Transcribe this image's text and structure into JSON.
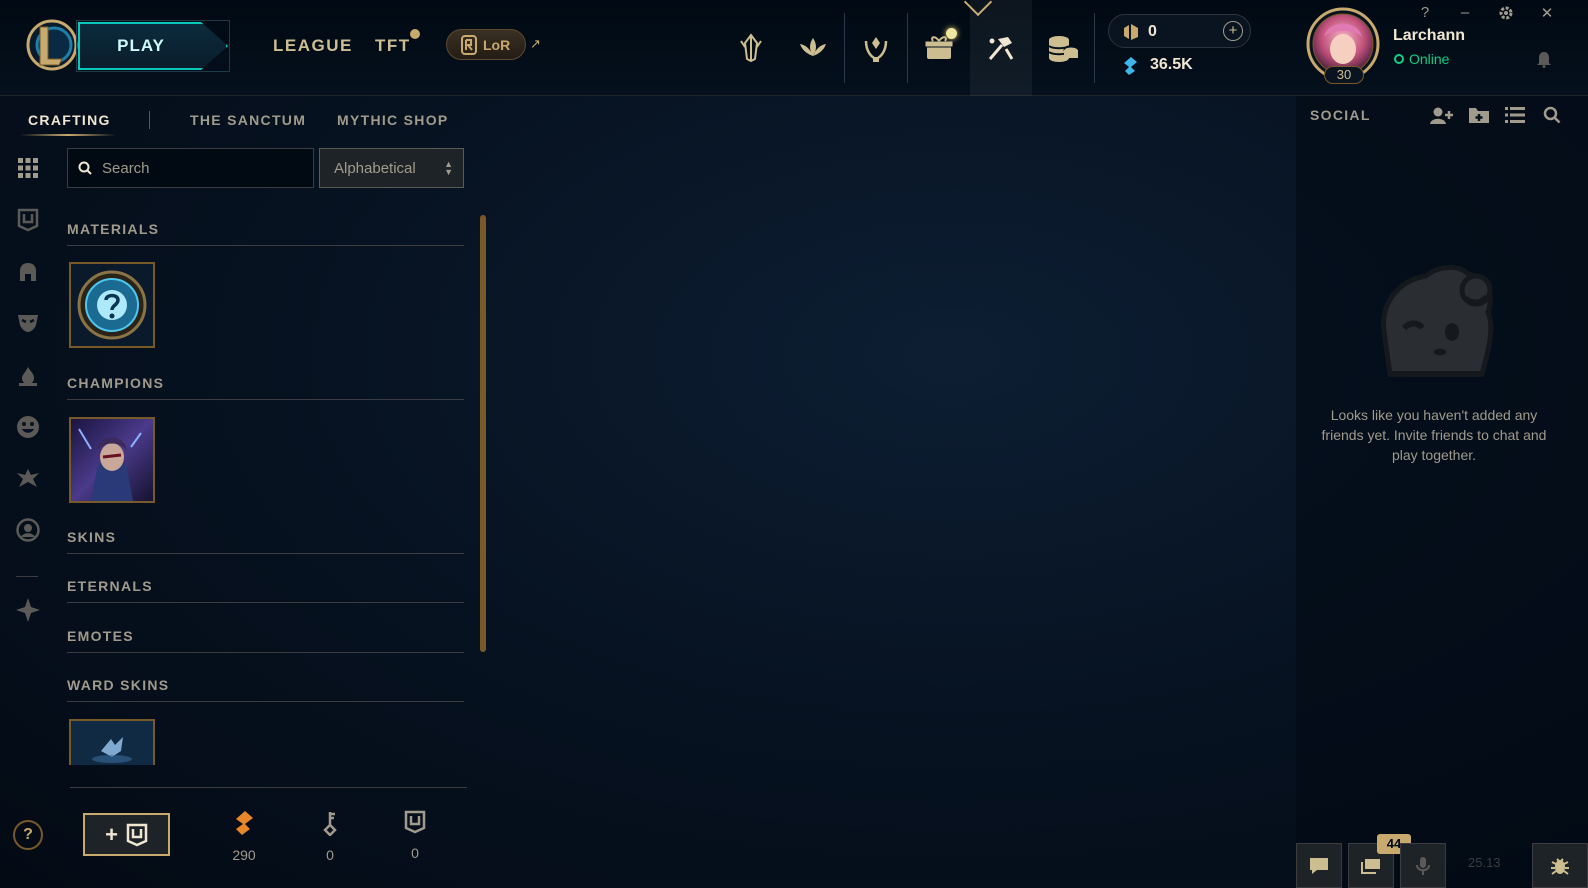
{
  "header": {
    "play_label": "PLAY",
    "nav": [
      {
        "label": "LEAGUE"
      },
      {
        "label": "TFT"
      }
    ],
    "lor_label": "LoR",
    "lor_external": "↗",
    "currencies": {
      "rp": "0",
      "rp_add": "+",
      "blue_essence": "36.5K"
    },
    "profile": {
      "name": "Larchann",
      "status": "Online",
      "level": "30"
    },
    "window_controls": {
      "help": "?",
      "minimize": "–",
      "close": "✕"
    }
  },
  "tabs": [
    {
      "label": "CRAFTING",
      "active": true
    },
    {
      "label": "THE SANCTUM",
      "active": false
    },
    {
      "label": "MYTHIC SHOP",
      "active": false
    }
  ],
  "search": {
    "placeholder": "Search",
    "value": ""
  },
  "sort": {
    "selected": "Alphabetical"
  },
  "sections": [
    {
      "title": "MATERIALS"
    },
    {
      "title": "CHAMPIONS"
    },
    {
      "title": "SKINS"
    },
    {
      "title": "ETERNALS"
    },
    {
      "title": "EMOTES"
    },
    {
      "title": "WARD SKINS"
    }
  ],
  "footer": {
    "add_label": "+",
    "orange_essence": "290",
    "keys": "0",
    "chests": "0",
    "help": "?"
  },
  "social": {
    "title": "SOCIAL",
    "empty_message": "Looks like you haven't added any friends yet. Invite friends to chat and play together.",
    "notification_count": "44",
    "version": "25.13"
  },
  "colors": {
    "gold": "#c8aa6e",
    "teal": "#0ac8b9",
    "online": "#0acf83",
    "background": "#071322"
  }
}
